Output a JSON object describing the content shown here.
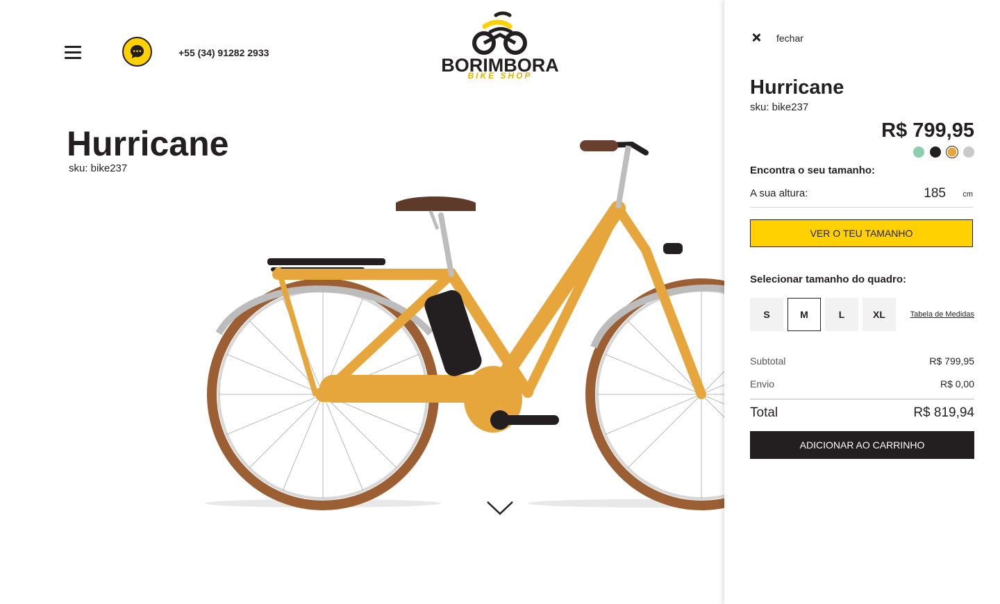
{
  "header": {
    "phone": "+55 (34) 91282 2933",
    "logo_word": "BORIMBORA",
    "logo_sub": "BIKE SHOP"
  },
  "product": {
    "name": "Hurricane",
    "sku": "sku: bike237",
    "price": "R$ 799,95",
    "frame_color": "#e7a63c",
    "swatches": [
      "#8ccfae",
      "#231f20",
      "#e7a63c",
      "#c9c9c9"
    ],
    "selected_swatch": 2
  },
  "panel": {
    "close_label": "fechar",
    "find_size_label": "Encontra o seu tamanho:",
    "height_label": "A sua altura:",
    "height_value": "185",
    "height_unit": "cm",
    "see_size_button": "VER O TEU TAMANHO",
    "frame_size_label": "Selecionar tamanho do quadro:",
    "sizes": [
      "S",
      "M",
      "L",
      "XL"
    ],
    "selected_size": "M",
    "size_chart_link": "Tabela de Medidas",
    "subtotal_label": "Subtotal",
    "subtotal_value": "R$ 799,95",
    "shipping_label": "Envio",
    "shipping_value": "R$ 0,00",
    "total_label": "Total",
    "total_value": "R$ 819,94",
    "add_to_cart_button": "ADICIONAR AO CARRINHO"
  },
  "colors": {
    "accent_yellow": "#ffd100",
    "dark": "#231f20"
  }
}
